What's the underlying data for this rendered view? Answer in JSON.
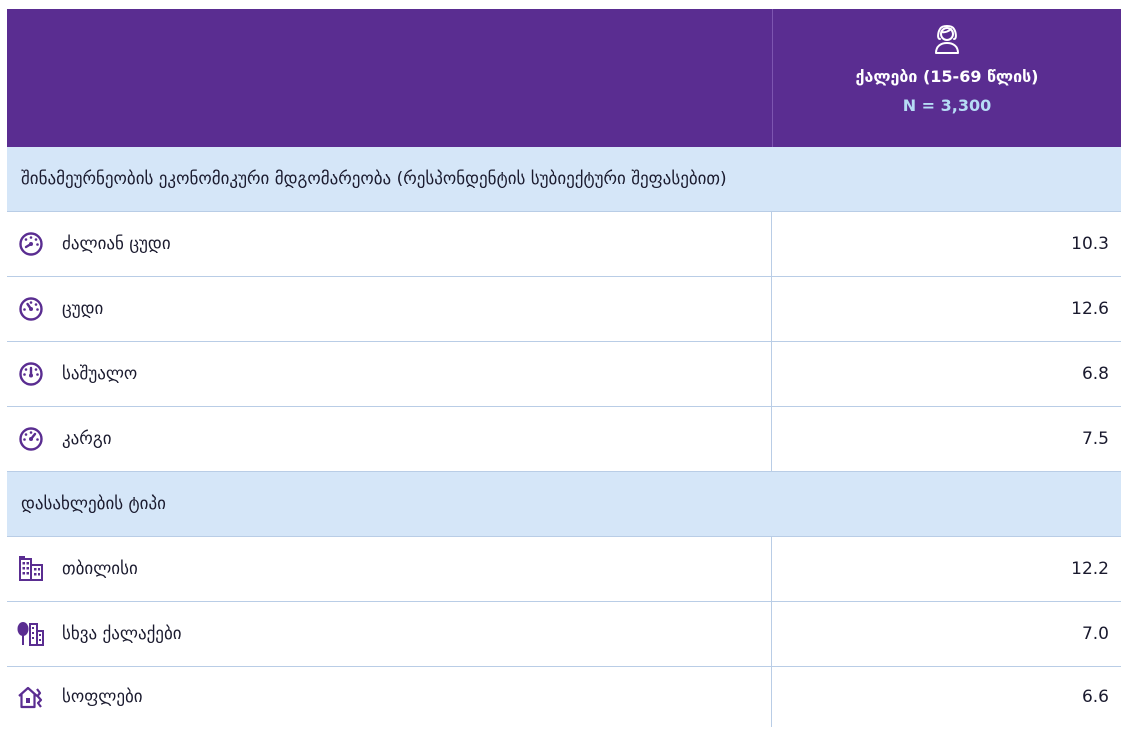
{
  "colors": {
    "header_bg": "#5a2d91",
    "section_bg": "#d5e6f8",
    "icon": "#5a2d91",
    "n_text": "#b6dcf5"
  },
  "header": {
    "icon": "woman-icon",
    "column_title": "ქალები (15-69 წლის)",
    "n_label": "N = 3,300"
  },
  "sections": [
    {
      "title": "შინამეურნეობის ეკონომიკური მდგომარეობა (რესპონდენტის სუბიექტური შეფასებით)",
      "rows": [
        {
          "icon": "gauge-very-low-icon",
          "label": "ძალიან ცუდი",
          "value": "10.3"
        },
        {
          "icon": "gauge-low-icon",
          "label": "ცუდი",
          "value": "12.6"
        },
        {
          "icon": "gauge-mid-icon",
          "label": "საშუალო",
          "value": "6.8"
        },
        {
          "icon": "gauge-high-icon",
          "label": "კარგი",
          "value": "7.5"
        }
      ]
    },
    {
      "title": "დასახლების ტიპი",
      "rows": [
        {
          "icon": "city-buildings-icon",
          "label": "თბილისი",
          "value": "12.2"
        },
        {
          "icon": "town-tree-icon",
          "label": "სხვა ქალაქები",
          "value": "7.0"
        },
        {
          "icon": "village-house-icon",
          "label": "სოფლები",
          "value": "6.6"
        }
      ]
    }
  ]
}
